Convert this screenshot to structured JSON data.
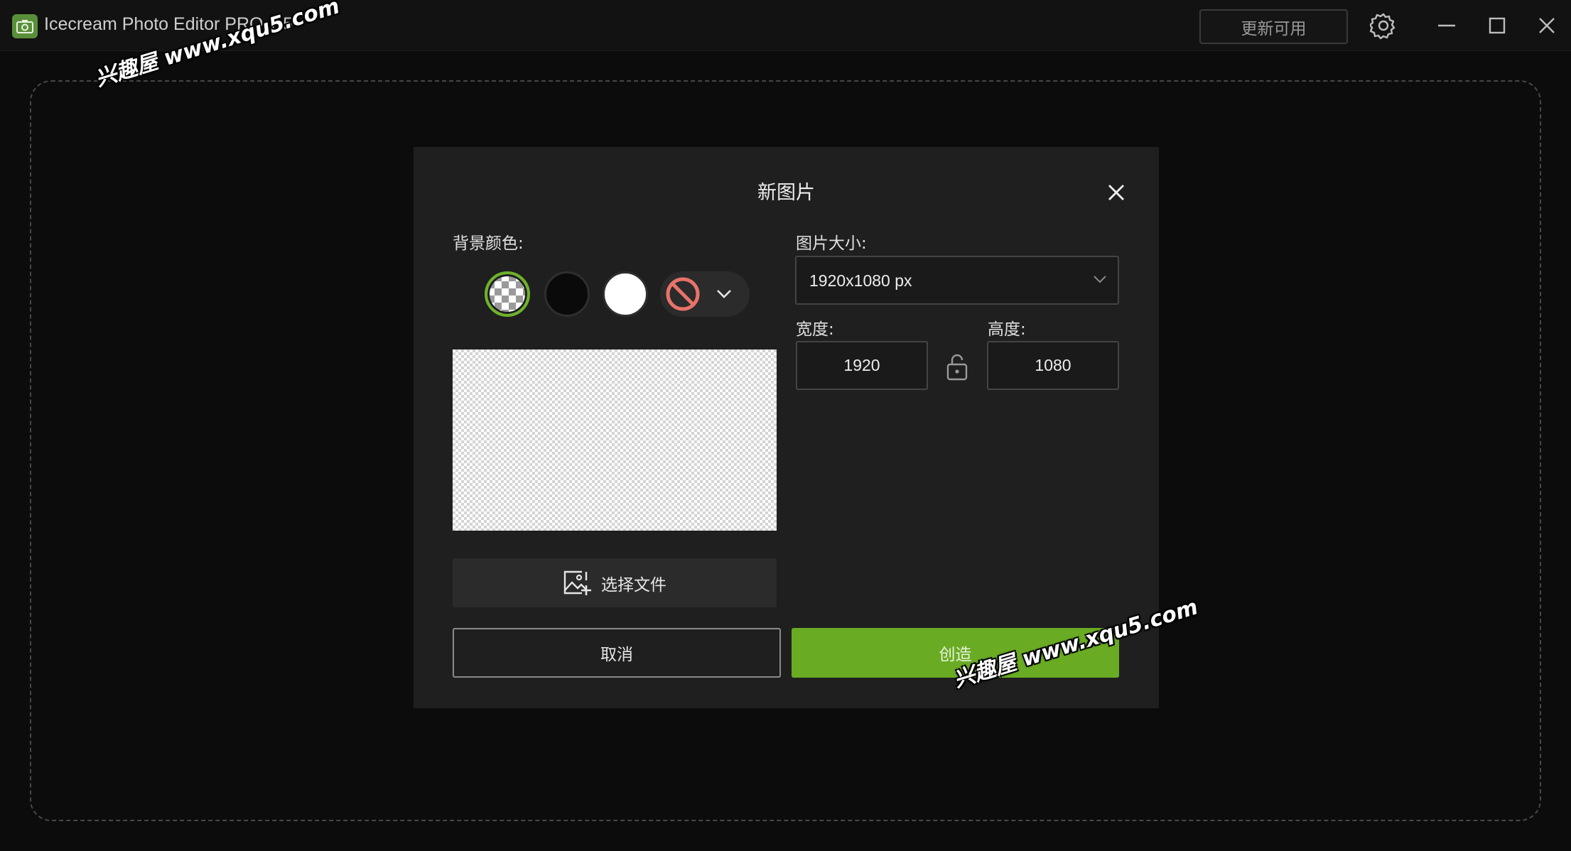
{
  "window": {
    "title": "Icecream Photo Editor PRO 1.5",
    "update_label": "更新可用"
  },
  "dialog": {
    "title": "新图片",
    "bg_color_label": "背景颜色:",
    "size_label": "图片大小:",
    "size_value": "1920x1080 px",
    "width_label": "宽度:",
    "width_value": "1920",
    "height_label": "高度:",
    "height_value": "1080",
    "choose_file_label": "选择文件",
    "cancel_label": "取消",
    "create_label": "创造",
    "selected_swatch": "transparent",
    "colors": {
      "accent": "#6aab24",
      "no_color": "#e8736b"
    }
  },
  "watermarks": [
    "兴趣屋 www.xqu5.com",
    "兴趣屋 www.xqu5.com"
  ]
}
